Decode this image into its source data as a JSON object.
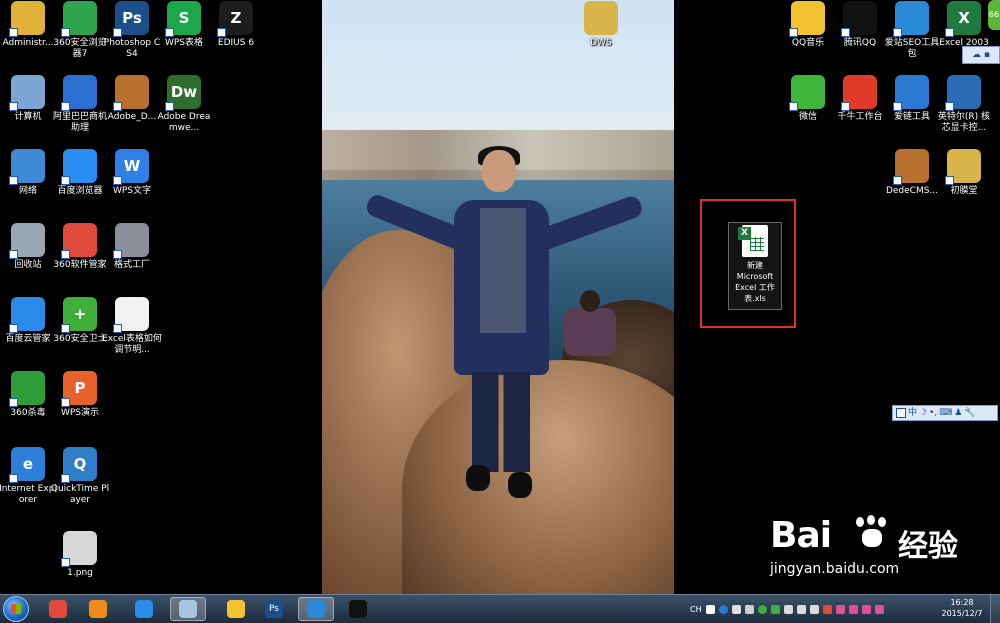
{
  "desktop": {
    "left_icons": [
      {
        "label": "Administr...",
        "icon": "folder-user-icon",
        "color": "#e0b23c"
      },
      {
        "label": "360安全浏览器7",
        "icon": "360-browser-icon",
        "color": "#2ea44f"
      },
      {
        "label": "Photoshop CS4",
        "icon": "photoshop-icon",
        "color": "#1a4f8c",
        "glyph": "Ps"
      },
      {
        "label": "WPS表格",
        "icon": "wps-spreadsheet-icon",
        "color": "#1ea64a",
        "glyph": "S"
      },
      {
        "label": "EDIUS 6",
        "icon": "edius-icon",
        "color": "#1d1d1d",
        "glyph": "Z"
      },
      {
        "label": "计算机",
        "icon": "computer-icon",
        "color": "#7da6d4"
      },
      {
        "label": "阿里巴巴商机助理",
        "icon": "alibaba-icon",
        "color": "#2b6fd0"
      },
      {
        "label": "Adobe_D...",
        "icon": "winrar-icon",
        "color": "#b8702e"
      },
      {
        "label": "Adobe Dreamwe...",
        "icon": "dreamweaver-icon",
        "color": "#2d6e2f",
        "glyph": "Dw"
      },
      {
        "label": "网络",
        "icon": "network-icon",
        "color": "#3e8ad6"
      },
      {
        "label": "百度浏览器",
        "icon": "baidu-browser-icon",
        "color": "#2a8cf0"
      },
      {
        "label": "WPS文字",
        "icon": "wps-writer-icon",
        "color": "#2f7fe4",
        "glyph": "W"
      },
      {
        "label": "回收站",
        "icon": "recycle-bin-icon",
        "color": "#9aa7b3"
      },
      {
        "label": "360软件管家",
        "icon": "360-software-icon",
        "color": "#e04a3a"
      },
      {
        "label": "格式工厂",
        "icon": "format-factory-icon",
        "color": "#8a8f99"
      },
      {
        "label": "百度云管家",
        "icon": "baidu-cloud-icon",
        "color": "#2b8be8"
      },
      {
        "label": "360安全卫士",
        "icon": "360-safe-icon",
        "color": "#3fae3a",
        "glyph": "+"
      },
      {
        "label": "Excel表格如何调节明...",
        "icon": "text-file-icon",
        "color": "#f2f2f2"
      },
      {
        "label": "360杀毒",
        "icon": "360-antivirus-icon",
        "color": "#2f9d3a"
      },
      {
        "label": "WPS演示",
        "icon": "wps-presentation-icon",
        "color": "#e8612b",
        "glyph": "P"
      },
      {
        "label": "Internet Explorer",
        "icon": "ie-icon",
        "color": "#2d7fd8",
        "glyph": "e"
      },
      {
        "label": "QuickTime Player",
        "icon": "quicktime-icon",
        "color": "#2e7ec9",
        "glyph": "Q"
      },
      {
        "label": "1.png",
        "icon": "image-file-icon",
        "color": "#d7d7d7"
      }
    ],
    "top_center_icon": {
      "label": "DWS",
      "icon": "folder-icon",
      "color": "#d9b44a"
    },
    "right_icons": [
      {
        "label": "QQ音乐",
        "icon": "qq-music-icon",
        "color": "#f2c230"
      },
      {
        "label": "腾讯QQ",
        "icon": "qq-icon",
        "color": "#111111"
      },
      {
        "label": "爱站SEO工具包",
        "icon": "aizhan-seo-icon",
        "color": "#2b8ad8"
      },
      {
        "label": "Excel 2003",
        "icon": "excel-icon",
        "color": "#1f7a3f",
        "glyph": "X"
      },
      {
        "label": "微信",
        "icon": "wechat-icon",
        "color": "#3fb53a"
      },
      {
        "label": "千牛工作台",
        "icon": "qianniu-icon",
        "color": "#e03a2b"
      },
      {
        "label": "爱链工具",
        "icon": "ailian-icon",
        "color": "#2b78d0"
      },
      {
        "label": "英特尔(R) 核芯显卡控...",
        "icon": "intel-graphics-icon",
        "color": "#2a6bb5"
      },
      {
        "label": "DedeCMS...",
        "icon": "winrar-icon",
        "color": "#b8702e"
      },
      {
        "label": "初膜堂",
        "icon": "folder-icon",
        "color": "#d9b44a"
      }
    ],
    "selected_file": {
      "label": "新建 Microsoft Excel 工作表.xls",
      "icon": "excel-file-icon"
    }
  },
  "ime_bar": {
    "items": [
      "中"
    ],
    "icon_names": [
      "ime-logo-icon",
      "moon-icon",
      "punctuation-icon",
      "keyboard-icon",
      "user-icon",
      "wrench-icon"
    ]
  },
  "corner_widget": {
    "label": "66",
    "icon": "baidu-widget-icon"
  },
  "watermark": {
    "brand": "Bai",
    "brand_cn": "经验",
    "du": "du",
    "url": "jingyan.baidu.com"
  },
  "taskbar": {
    "apps": [
      {
        "name": "start-button",
        "color": "#1c6bc4"
      },
      {
        "name": "taskbar-app-360-icon",
        "color": "#e04a3a"
      },
      {
        "name": "taskbar-app-media-icon",
        "color": "#f08a1a"
      },
      {
        "name": "taskbar-app-baidu-cloud-icon",
        "color": "#2b8be8"
      },
      {
        "name": "taskbar-app-window-icon",
        "color": "#a8c4de",
        "active": true
      },
      {
        "name": "taskbar-app-browser-icon",
        "color": "#f2c230"
      },
      {
        "name": "taskbar-app-photoshop-icon",
        "color": "#1a4f8c",
        "glyph": "Ps"
      },
      {
        "name": "taskbar-app-safari-icon",
        "color": "#2b8ad8",
        "active": true
      },
      {
        "name": "taskbar-app-qq-icon",
        "color": "#111111"
      }
    ],
    "tray_text": [
      "CH"
    ],
    "clock": {
      "time": "16:28",
      "date": "2015/12/7"
    }
  }
}
